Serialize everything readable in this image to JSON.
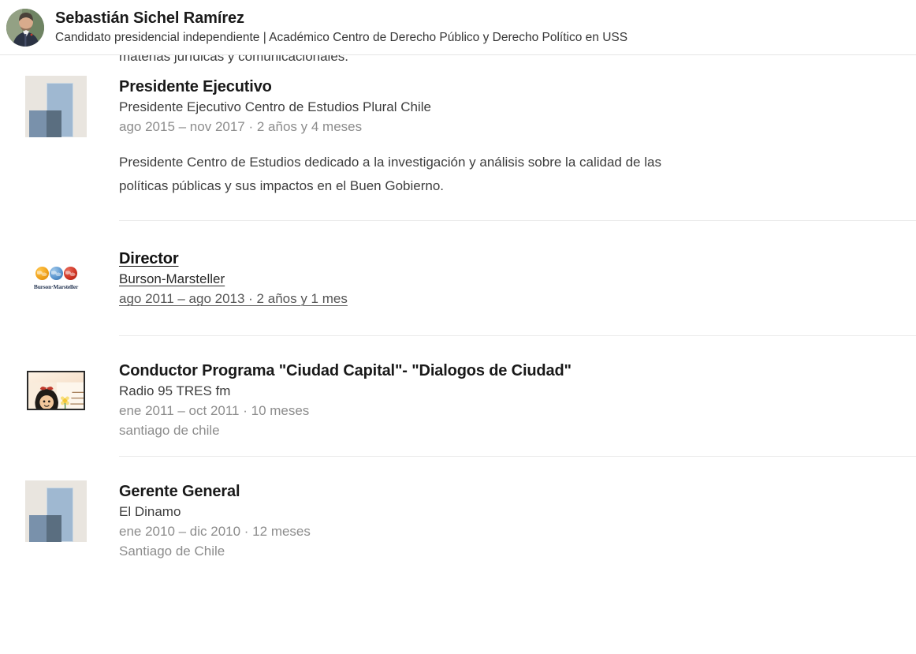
{
  "header": {
    "name": "Sebastián Sichel Ramírez",
    "headline": "Candidato presidencial independiente | Académico Centro de Derecho Público y Derecho Político en USS",
    "avatar_icon": "profile-photo"
  },
  "clipped_text": "materias jurídicas y comunicacionales.",
  "experience": [
    {
      "title": "Presidente Ejecutivo",
      "company": "Presidente Ejecutivo Centro de Estudios Plural Chile",
      "dates": "ago 2015 – nov 2017 · 2 años y 4 meses",
      "location": "",
      "description_line1": "Presidente Centro de Estudios dedicado a la investigación y análisis sobre la calidad de las",
      "description_line2": "políticas públicas y sus impactos en el Buen Gobierno.",
      "logo_type": "placeholder-company-logo",
      "hovered": false
    },
    {
      "title": "Director",
      "company": "Burson-Marsteller",
      "dates": "ago 2011 – ago 2013 · 2 años y 1 mes",
      "location": "",
      "description_line1": "",
      "description_line2": "",
      "logo_type": "burson-marsteller-logo",
      "logo_word": "Burson·Marsteller",
      "hovered": true
    },
    {
      "title": "Conductor Programa \"Ciudad Capital\"- \"Dialogos de Ciudad\"",
      "company": "Radio 95 TRES fm",
      "dates": "ene 2011 – oct 2011 · 10 meses",
      "location": "santiago de chile",
      "description_line1": "",
      "description_line2": "",
      "logo_type": "mafalda-cartoon-logo",
      "hovered": false
    },
    {
      "title": "Gerente General",
      "company": "El Dinamo",
      "dates": "ene 2010 – dic 2010 · 12 meses",
      "location": "Santiago de Chile",
      "description_line1": "",
      "description_line2": "",
      "logo_type": "placeholder-company-logo",
      "hovered": false
    }
  ],
  "colors": {
    "title_text": "#191919",
    "body_text": "#3d3d3d",
    "muted_text": "#8c8c8c",
    "divider": "#ececec",
    "placeholder_bg": "#e9e5df",
    "placeholder_bar": "#9fb8d1"
  }
}
